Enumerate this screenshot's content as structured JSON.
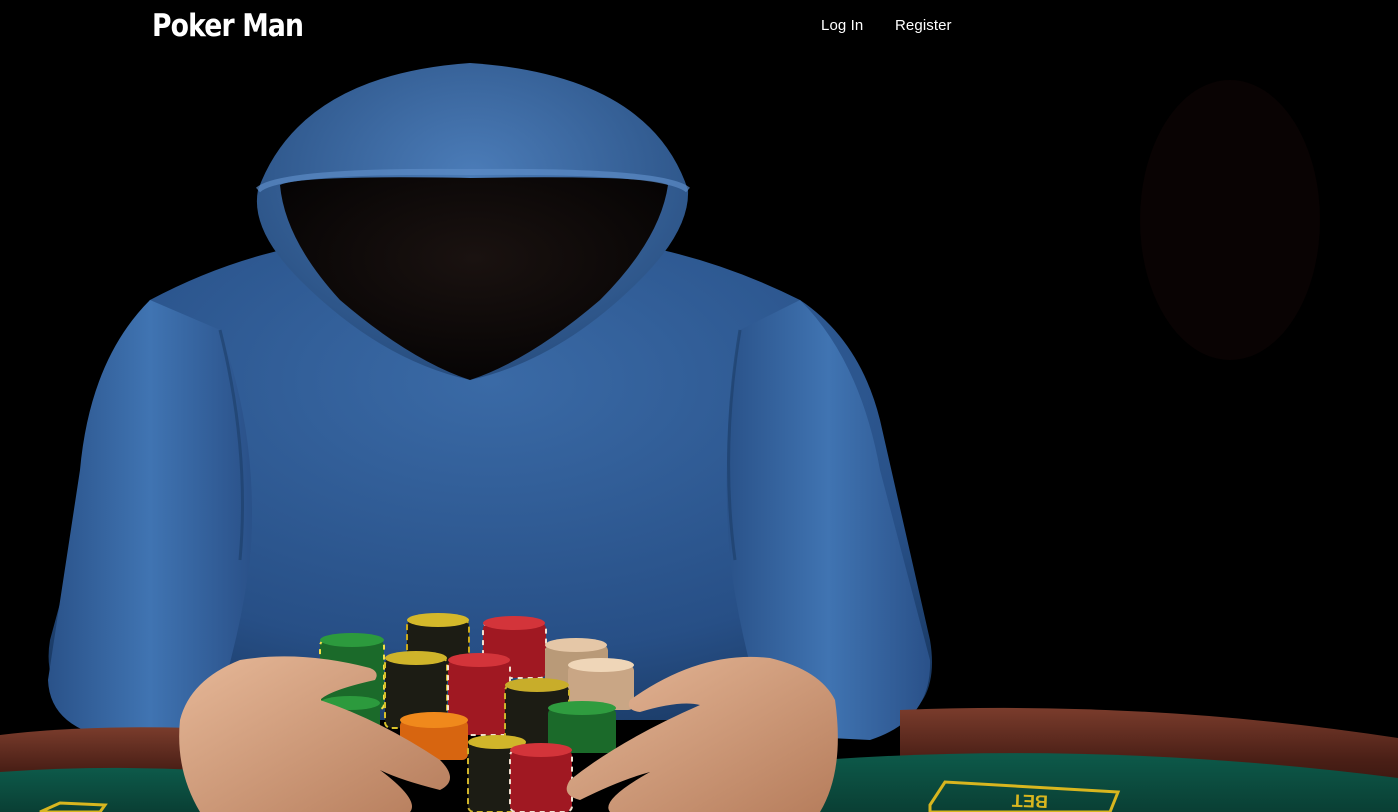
{
  "nav": {
    "brand": "Poker Man",
    "links": [
      {
        "label": "Log In"
      },
      {
        "label": "Register"
      }
    ]
  },
  "hero": {
    "image_subject": "hooded-poker-player-with-chips",
    "table_marking": "BET"
  },
  "colors": {
    "navbar_bg": "#000000",
    "nav_text": "#ffffff",
    "hoodie": "#2d5d98",
    "felt": "#0d4a3d",
    "table_rail": "#4a1f16",
    "bet_box": "#d8b61f"
  }
}
